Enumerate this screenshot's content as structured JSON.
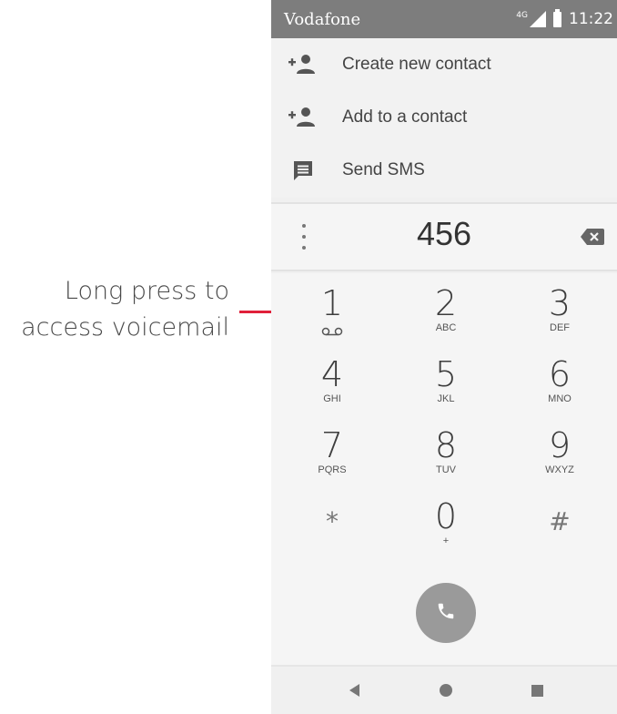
{
  "annotation": {
    "line1": "Long press to",
    "line2": "access voicemail",
    "accent_color": "#e0203a"
  },
  "status_bar": {
    "carrier": "Vodafone",
    "network_type": "4G",
    "time": "11:22"
  },
  "menu": {
    "items": [
      {
        "label": "Create new contact",
        "icon": "add-person-icon"
      },
      {
        "label": "Add to a contact",
        "icon": "add-person-icon"
      },
      {
        "label": "Send SMS",
        "icon": "message-icon"
      }
    ]
  },
  "dialer": {
    "digits": "456",
    "keys": [
      {
        "digit": "1",
        "sub": "voicemail-icon"
      },
      {
        "digit": "2",
        "sub": "ABC"
      },
      {
        "digit": "3",
        "sub": "DEF"
      },
      {
        "digit": "4",
        "sub": "GHI"
      },
      {
        "digit": "5",
        "sub": "JKL"
      },
      {
        "digit": "6",
        "sub": "MNO"
      },
      {
        "digit": "7",
        "sub": "PQRS"
      },
      {
        "digit": "8",
        "sub": "TUV"
      },
      {
        "digit": "9",
        "sub": "WXYZ"
      },
      {
        "digit": "*",
        "sub": ""
      },
      {
        "digit": "0",
        "sub": "+"
      },
      {
        "digit": "#",
        "sub": ""
      }
    ]
  }
}
